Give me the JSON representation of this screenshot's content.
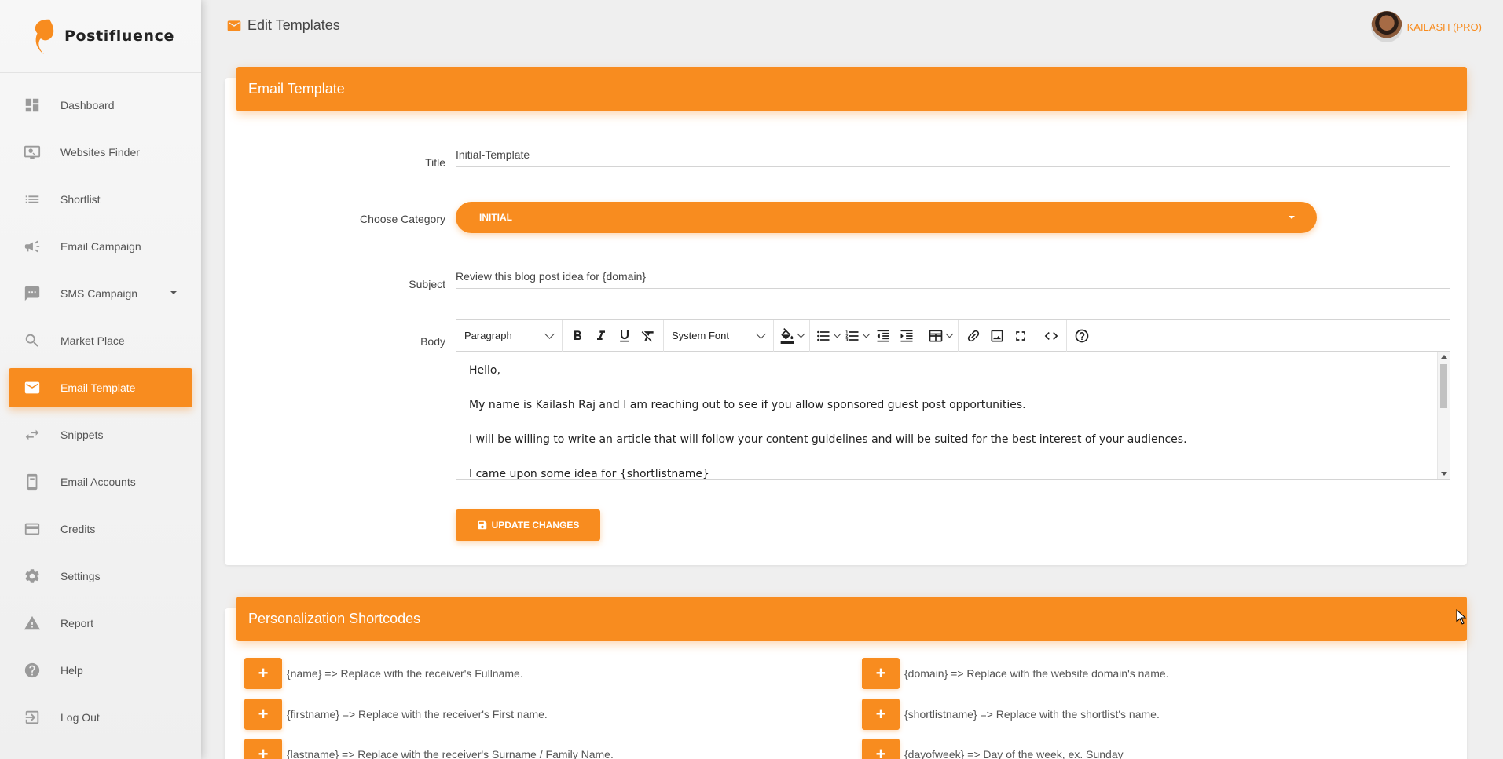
{
  "brand": {
    "name": "Postifluence"
  },
  "sidebar": {
    "items": [
      {
        "label": "Dashboard",
        "icon": "dashboard-icon"
      },
      {
        "label": "Websites Finder",
        "icon": "monitor-search-icon"
      },
      {
        "label": "Shortlist",
        "icon": "list-icon"
      },
      {
        "label": "Email Campaign",
        "icon": "megaphone-icon"
      },
      {
        "label": "SMS Campaign",
        "icon": "chat-icon"
      },
      {
        "label": "Market Place",
        "icon": "search-icon"
      },
      {
        "label": "Email Template",
        "icon": "mail-icon",
        "active": true
      },
      {
        "label": "Snippets",
        "icon": "swap-icon"
      },
      {
        "label": "Email Accounts",
        "icon": "phone-icon"
      },
      {
        "label": "Credits",
        "icon": "credit-card-icon"
      },
      {
        "label": "Settings",
        "icon": "gear-icon"
      },
      {
        "label": "Report",
        "icon": "warning-icon"
      },
      {
        "label": "Help",
        "icon": "help-icon"
      },
      {
        "label": "Log Out",
        "icon": "logout-icon"
      }
    ]
  },
  "header": {
    "title": "Edit Templates",
    "user": "KAILASH (PRO)"
  },
  "template_card": {
    "header": "Email Template",
    "title_label": "Title",
    "title_value": "Initial-Template",
    "category_label": "Choose Category",
    "category_value": "INITIAL",
    "subject_label": "Subject",
    "subject_value": "Review this blog post idea for {domain}",
    "body_label": "Body",
    "toolbar": {
      "block_format": "Paragraph",
      "font_family": "System Font"
    },
    "body": {
      "greeting": "Hello,",
      "p1": "My name is Kailash Raj and I am reaching out to see if you allow sponsored guest post opportunities.",
      "p2": "I will be willing to write an article that will follow your content guidelines and will be suited for the best interest of your audiences.",
      "p3": "I came upon some idea for {shortlistname}"
    },
    "update_button": "UPDATE CHANGES"
  },
  "shortcodes_card": {
    "header": "Personalization Shortcodes",
    "plus_label": "+",
    "left": [
      "{name} => Replace with the receiver's Fullname.",
      "{firstname} => Replace with the receiver's First name.",
      "{lastname} => Replace with the receiver's Surname / Family Name."
    ],
    "right": [
      "{domain} => Replace with the website domain's name.",
      "{shortlistname} => Replace with the shortlist's name.",
      "{dayofweek} => Day of the week, ex. Sunday"
    ]
  },
  "colors": {
    "accent": "#f88c1f",
    "background": "#efefef"
  }
}
